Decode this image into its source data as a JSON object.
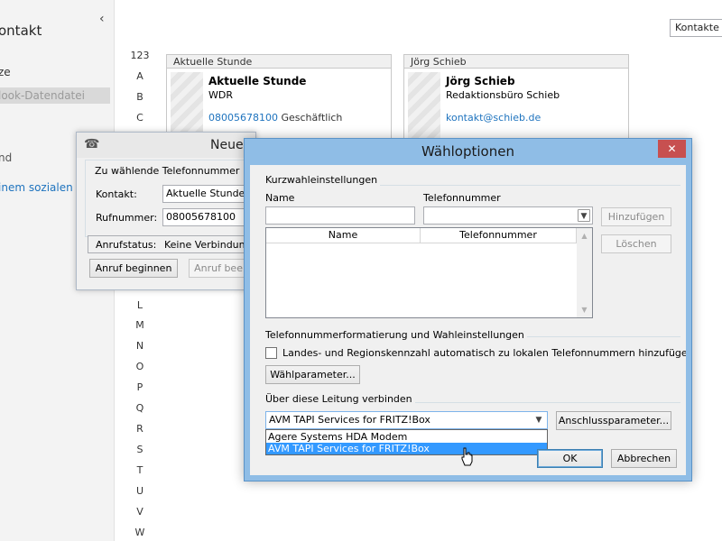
{
  "left_pane": {
    "title": "ontakt",
    "items": [
      {
        "label": "ze",
        "color": "#333333"
      },
      {
        "label": "look-Datendatei",
        "color": "#9a9a9a"
      },
      {
        "label": "nd",
        "color": "#555555"
      },
      {
        "label": "inem sozialen Ne",
        "color": "#1e73be"
      }
    ]
  },
  "alphabet_index": [
    "123",
    "A",
    "B",
    "C",
    "L",
    "M",
    "N",
    "O",
    "P",
    "Q",
    "R",
    "S",
    "T",
    "U",
    "V",
    "W"
  ],
  "view_select": {
    "value": "Kontakte o"
  },
  "cards": [
    {
      "header": "Aktuelle Stunde",
      "name": "Aktuelle Stunde",
      "org": "WDR",
      "link": "08005678100",
      "link_type": "Geschäftlich"
    },
    {
      "header": "Jörg Schieb",
      "name": "Jörg Schieb",
      "org": "Redaktionsbüro Schieb",
      "link": "kontakt@schieb.de",
      "link_type": ""
    }
  ],
  "call_dialog": {
    "title": "Neuer",
    "group_caption": "Zu wählende Telefonnummer",
    "contact_label": "Kontakt:",
    "contact_value": "Aktuelle Stunde",
    "number_label": "Rufnummer:",
    "number_value": "08005678100",
    "status_label": "Anrufstatus:",
    "status_value": "Keine Verbindung",
    "start_call_label": "Anruf beginnen",
    "end_call_label": "Anruf beend"
  },
  "dial_options": {
    "title": "Wähloptionen",
    "close_glyph": "✕",
    "speed_dial": {
      "caption": "Kurzwahleinstellungen",
      "name_label": "Name",
      "name_value": "",
      "phone_label": "Telefonnummer",
      "phone_value": "",
      "add_label": "Hinzufügen",
      "delete_label": "Löschen",
      "columns": [
        "Name",
        "Telefonnummer"
      ]
    },
    "formatting": {
      "caption": "Telefonnummerformatierung und Wahleinstellungen",
      "checkbox_label": "Landes- und Regionskennzahl automatisch zu lokalen Telefonnummern hinzufügen",
      "checkbox_checked": false,
      "dialing_params_label": "Wählparameter..."
    },
    "connection": {
      "caption": "Über diese Leitung verbinden",
      "selected": "AVM TAPI Services for FRITZ!Box",
      "options": [
        "Agere Systems HDA Modem",
        "AVM TAPI Services for FRITZ!Box"
      ],
      "highlighted_option": "AVM TAPI Services for FRITZ!Box",
      "port_params_label": "Anschlussparameter..."
    },
    "ok_label": "OK",
    "cancel_label": "Abbrechen"
  },
  "colors": {
    "titlebar": "#8fbde6",
    "close_button": "#c75050",
    "selection": "#3399ff",
    "link": "#1e73be"
  }
}
